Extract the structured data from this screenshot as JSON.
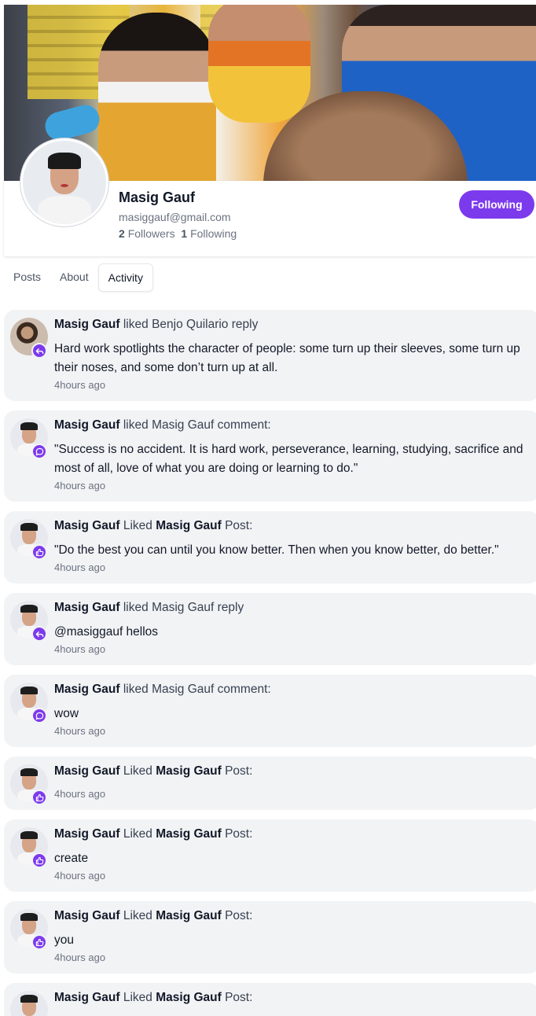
{
  "profile": {
    "name": "Masig Gauf",
    "email": "masiggauf@gmail.com",
    "followers_count": "2",
    "followers_label": "Followers",
    "following_count": "1",
    "following_label": "Following",
    "follow_button": "Following"
  },
  "tabs": [
    {
      "label": "Posts"
    },
    {
      "label": "About"
    },
    {
      "label": "Activity",
      "active": true
    }
  ],
  "accent_color": "#7c3aed",
  "activities": [
    {
      "actor": "Masig Gauf",
      "verb": "liked",
      "target": "Benjo Quilario",
      "object": "reply",
      "body": "Hard work spotlights the character of people: some turn up their sleeves, some turn up their noses, and some don’t turn up at all.",
      "time": "4hours ago",
      "icon": "reply-icon"
    },
    {
      "actor": "Masig Gauf",
      "verb": "liked",
      "target": "Masig Gauf",
      "object": "comment:",
      "body": "\"Success is no accident. It is hard work, perseverance, learning, studying, sacrifice and most of all, love of what you are doing or learning to do.\"",
      "time": "4hours ago",
      "icon": "comment-icon"
    },
    {
      "actor": "Masig Gauf",
      "verb": "Liked",
      "target": "Masig Gauf",
      "object": "Post:",
      "body": "\"Do the best you can until you know better. Then when you know better, do better.\"",
      "time": "4hours ago",
      "icon": "thumbs-up-icon"
    },
    {
      "actor": "Masig Gauf",
      "verb": "liked",
      "target": "Masig Gauf",
      "object": "reply",
      "body": "@masiggauf hellos",
      "time": "4hours ago",
      "icon": "reply-icon"
    },
    {
      "actor": "Masig Gauf",
      "verb": "liked",
      "target": "Masig Gauf",
      "object": "comment:",
      "body": "wow",
      "time": "4hours ago",
      "icon": "comment-icon"
    },
    {
      "actor": "Masig Gauf",
      "verb": "Liked",
      "target": "Masig Gauf",
      "object": "Post:",
      "body": "",
      "time": "4hours ago",
      "icon": "thumbs-up-icon"
    },
    {
      "actor": "Masig Gauf",
      "verb": "Liked",
      "target": "Masig Gauf",
      "object": "Post:",
      "body": "create",
      "time": "4hours ago",
      "icon": "thumbs-up-icon"
    },
    {
      "actor": "Masig Gauf",
      "verb": "Liked",
      "target": "Masig Gauf",
      "object": "Post:",
      "body": "you",
      "time": "4hours ago",
      "icon": "thumbs-up-icon"
    },
    {
      "actor": "Masig Gauf",
      "verb": "Liked",
      "target": "Masig Gauf",
      "object": "Post:",
      "body": "",
      "time": "",
      "icon": "thumbs-up-icon"
    }
  ]
}
